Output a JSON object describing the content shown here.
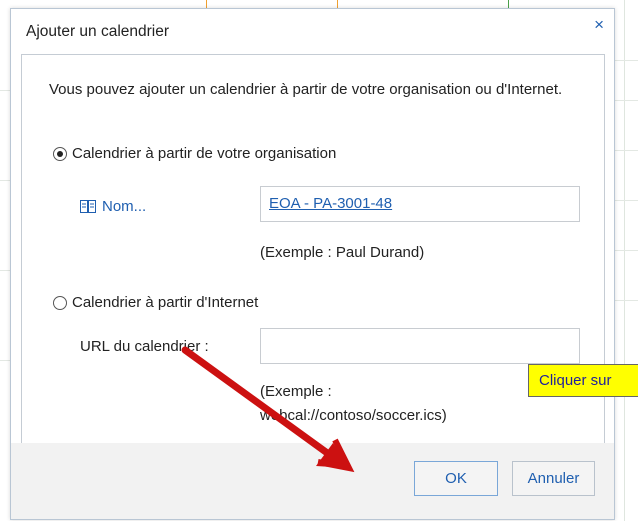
{
  "dialog": {
    "title": "Ajouter un calendrier",
    "close_label": "×",
    "intro": "Vous pouvez ajouter un calendrier à partir de votre organisation ou d'Internet.",
    "org_option": {
      "label": "Calendrier à partir de votre organisation",
      "selected": true,
      "name_link": "Nom...",
      "value": "EOA - PA-3001-48",
      "example": "(Exemple : Paul Durand)"
    },
    "internet_option": {
      "label": "Calendrier à partir d'Internet",
      "selected": false,
      "url_label": "URL du calendrier :",
      "url_value": "",
      "example_line1": "(Exemple :",
      "example_line2": "webcal://contoso/soccer.ics)"
    },
    "buttons": {
      "ok": "OK",
      "cancel": "Annuler"
    }
  },
  "annotation": {
    "callout": "Cliquer sur",
    "arrow_color": "#cc1111",
    "callout_color": "#ffff00"
  },
  "colors": {
    "accent": "#1f5fb0",
    "footer_bg": "#f2f2f2"
  }
}
